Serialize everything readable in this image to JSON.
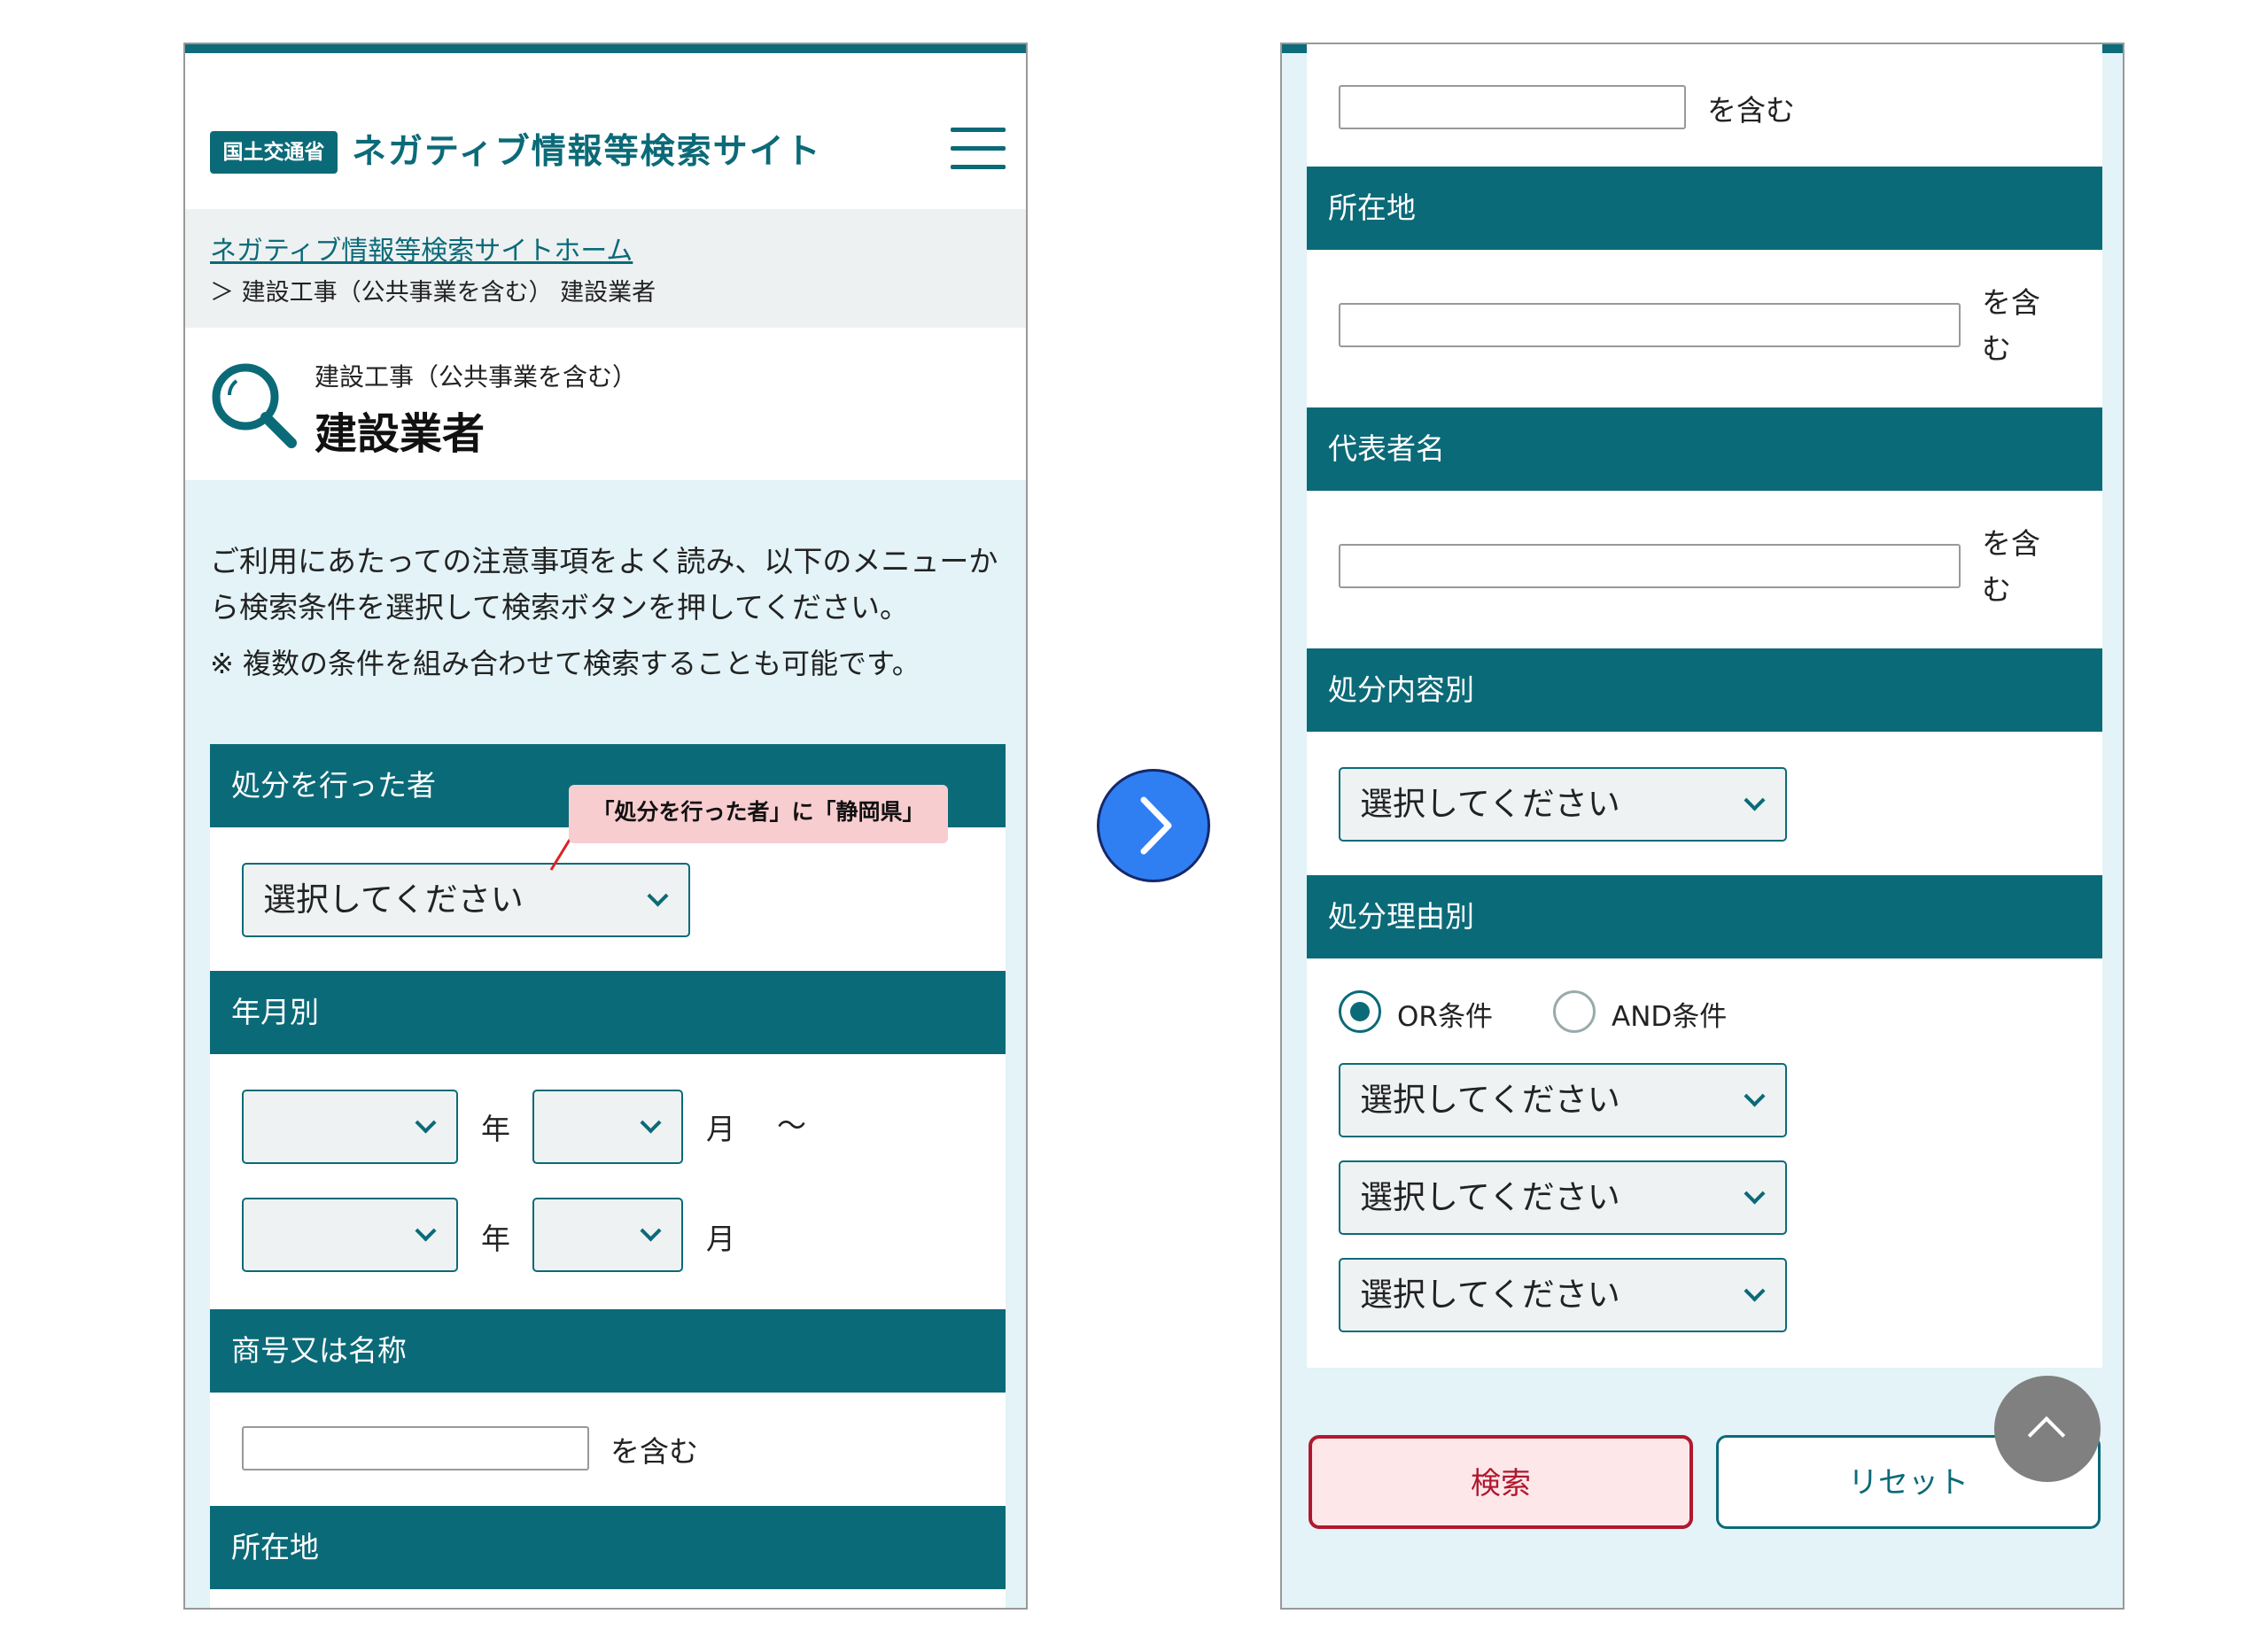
{
  "header": {
    "agency_badge": "国土交通省",
    "site_name": "ネガティブ情報等検索サイト"
  },
  "breadcrumb": {
    "home": "ネガティブ情報等検索サイトホーム",
    "current": "＞ 建設工事（公共事業を含む） 建設業者"
  },
  "page_title": {
    "category": "建設工事（公共事業を含む）",
    "title": "建設業者"
  },
  "intro": {
    "text": "ご利用にあたっての注意事項をよく読み、以下のメニューから検索条件を選択して検索ボタンを押してください。",
    "note": "※ 複数の条件を組み合わせて検索することも可能です。"
  },
  "sections": {
    "actor": "処分を行った者",
    "period": "年月別",
    "company": "商号又は名称",
    "address": "所在地",
    "representative": "代表者名",
    "disposition": "処分内容別",
    "reason": "処分理由別"
  },
  "selects": {
    "placeholder": "選択してください"
  },
  "labels": {
    "year": "年",
    "month": "月",
    "tilde": "〜",
    "contains": "を含む"
  },
  "callout": {
    "text": "「処分を行った者」に「静岡県」"
  },
  "reason_mode": {
    "or_label": "OR条件",
    "and_label": "AND条件",
    "selected": "OR条件"
  },
  "buttons": {
    "search": "検索",
    "reset": "リセット"
  },
  "colors": {
    "primary": "#0b6a78",
    "background": "#e3f3f7",
    "search_border": "#b0182e",
    "callout": "#f8cdd0",
    "next_arrow": "#2f7ff2"
  },
  "icons": {
    "menu": "hamburger-icon",
    "title": "search-icon",
    "next": "chevron-right-icon",
    "scroll_top": "chevron-up-icon"
  }
}
